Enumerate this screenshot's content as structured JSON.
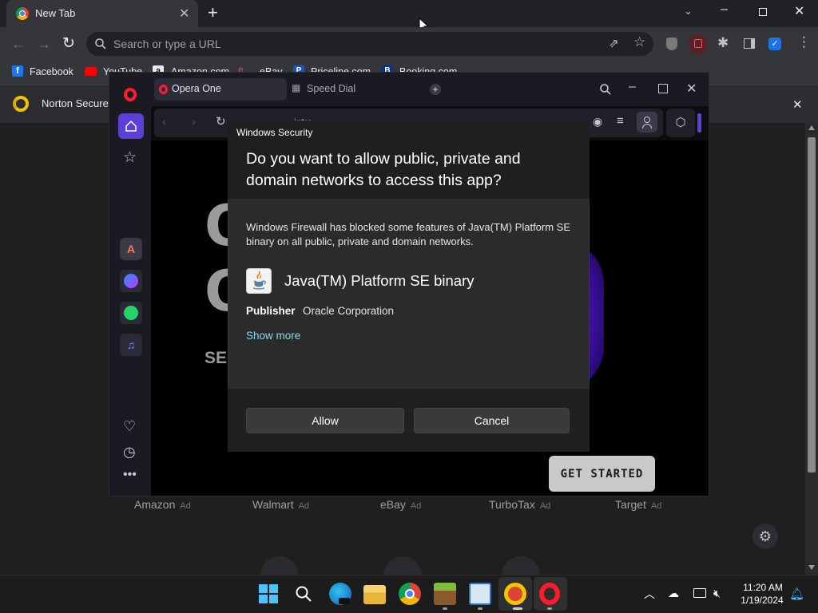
{
  "chrome": {
    "tab_title": "New Tab",
    "omnibox_placeholder": "Search or type a URL",
    "bookmarks": [
      "Facebook",
      "YouTube",
      "Amazon.com",
      "eBay",
      "Priceline.com",
      "Booking.com"
    ],
    "infobar_text": "Norton Secure",
    "shortcuts": [
      {
        "label": "Amazon",
        "tag": "Ad"
      },
      {
        "label": "Walmart",
        "tag": "Ad"
      },
      {
        "label": "eBay",
        "tag": "Ad"
      },
      {
        "label": "TurboTax",
        "tag": "Ad"
      },
      {
        "label": "Target",
        "tag": "Ad"
      }
    ]
  },
  "opera": {
    "tabs": [
      "Opera One",
      "Speed Dial"
    ],
    "address_fragment": "intro",
    "content_fragments": [
      "O",
      "O",
      "SE"
    ],
    "get_started_label": "GET STARTED"
  },
  "dialog": {
    "caption": "Windows Security",
    "question": "Do you want to allow public, private and domain networks to access this app?",
    "body": "Windows Firewall has blocked some features of Java(TM) Platform SE binary on all public, private and domain networks.",
    "app_name": "Java(TM) Platform SE binary",
    "publisher_label": "Publisher",
    "publisher_value": "Oracle Corporation",
    "show_more_label": "Show more",
    "allow_label": "Allow",
    "cancel_label": "Cancel"
  },
  "taskbar": {
    "time": "11:20 AM",
    "date": "1/19/2024"
  },
  "colors": {
    "chrome_dark": "#202124",
    "chrome_toolbar": "#35363a",
    "opera_accent": "#5b3fd6",
    "dialog_link": "#8fd6ea",
    "opera_red": "#ff1b2d"
  }
}
